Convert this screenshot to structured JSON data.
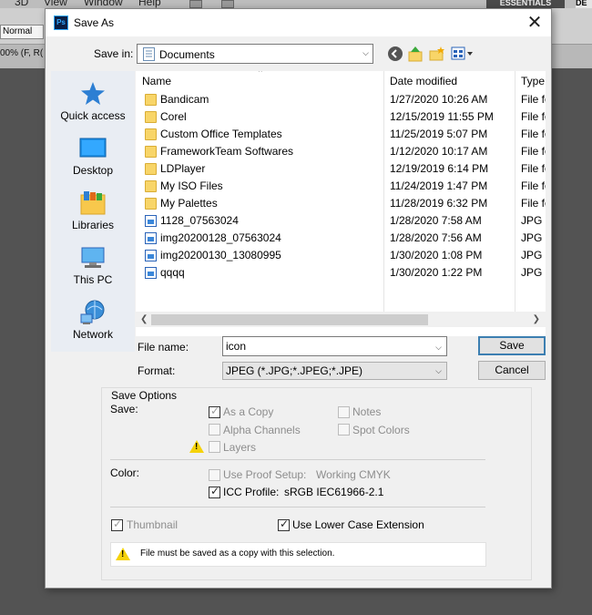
{
  "background_app": {
    "menu_items": [
      "3D",
      "View",
      "Window",
      "Help"
    ],
    "workspace": "ESSENTIALS",
    "workspace_next": "DE",
    "blend_mode": "Normal",
    "doc_tab": "00% (F, R("
  },
  "dialog": {
    "title": "Save As",
    "close": "✕",
    "save_in_label": "Save in:",
    "save_in_value": "Documents"
  },
  "places": [
    {
      "label": "Quick access",
      "icon": "star-icon"
    },
    {
      "label": "Desktop",
      "icon": "desktop-icon"
    },
    {
      "label": "Libraries",
      "icon": "libraries-icon"
    },
    {
      "label": "This PC",
      "icon": "computer-icon"
    },
    {
      "label": "Network",
      "icon": "network-icon"
    }
  ],
  "file_list": {
    "columns": [
      "Name",
      "Date modified",
      "Type"
    ],
    "rows": [
      {
        "name": "Bandicam",
        "date": "1/27/2020 10:26 AM",
        "type": "File fo",
        "kind": "folder"
      },
      {
        "name": "Corel",
        "date": "12/15/2019 11:55 PM",
        "type": "File fo",
        "kind": "folder"
      },
      {
        "name": "Custom Office Templates",
        "date": "11/25/2019 5:07 PM",
        "type": "File fo",
        "kind": "folder"
      },
      {
        "name": "FrameworkTeam Softwares",
        "date": "1/12/2020 10:17 AM",
        "type": "File fo",
        "kind": "folder"
      },
      {
        "name": "LDPlayer",
        "date": "12/19/2019 6:14 PM",
        "type": "File fo",
        "kind": "folder"
      },
      {
        "name": "My ISO Files",
        "date": "11/24/2019 1:47 PM",
        "type": "File fo",
        "kind": "folder"
      },
      {
        "name": "My Palettes",
        "date": "11/28/2019 6:32 PM",
        "type": "File fo",
        "kind": "folder"
      },
      {
        "name": "1128_07563024",
        "date": "1/28/2020 7:58 AM",
        "type": "JPG F",
        "kind": "image"
      },
      {
        "name": "img20200128_07563024",
        "date": "1/28/2020 7:56 AM",
        "type": "JPG F",
        "kind": "image"
      },
      {
        "name": "img20200130_13080995",
        "date": "1/30/2020 1:08 PM",
        "type": "JPG F",
        "kind": "image"
      },
      {
        "name": "qqqq",
        "date": "1/30/2020 1:22 PM",
        "type": "JPG F",
        "kind": "image"
      }
    ]
  },
  "form": {
    "file_name_label": "File name:",
    "file_name_value": "icon",
    "format_label": "Format:",
    "format_value": "JPEG (*.JPG;*.JPEG;*.JPE)",
    "save_button": "Save",
    "cancel_button": "Cancel"
  },
  "options": {
    "title": "Save Options",
    "save_label": "Save:",
    "as_a_copy": {
      "label": "As a Copy",
      "checked": true,
      "enabled": false
    },
    "notes": {
      "label": "Notes",
      "checked": false,
      "enabled": false
    },
    "alpha_channels": {
      "label": "Alpha Channels",
      "checked": false,
      "enabled": false
    },
    "spot_colors": {
      "label": "Spot Colors",
      "checked": false,
      "enabled": false
    },
    "layers": {
      "label": "Layers",
      "checked": false,
      "enabled": false
    },
    "color_label": "Color:",
    "use_proof_setup": {
      "label": "Use Proof Setup:",
      "value": "Working CMYK",
      "checked": false,
      "enabled": false
    },
    "icc_profile": {
      "label": "ICC Profile:",
      "value": "sRGB IEC61966-2.1",
      "checked": true,
      "enabled": true
    },
    "thumbnail": {
      "label": "Thumbnail",
      "checked": true,
      "enabled": false
    },
    "lower_case_ext": {
      "label": "Use Lower Case Extension",
      "checked": true,
      "enabled": true
    },
    "warning_text": "File must be saved as a copy with this selection."
  }
}
